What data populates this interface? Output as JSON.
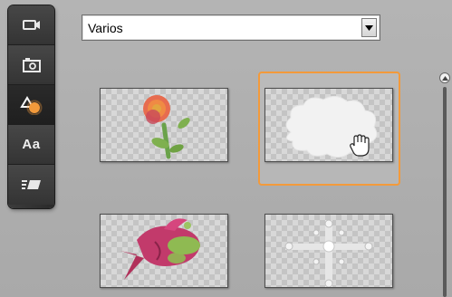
{
  "dropdown": {
    "selected": "Varios"
  },
  "toolbar": {
    "items": [
      {
        "name": "video-titles",
        "icon": "video-camera-icon"
      },
      {
        "name": "photos",
        "icon": "camera-icon"
      },
      {
        "name": "shapes",
        "icon": "shapes-icon",
        "active": true
      },
      {
        "name": "text",
        "icon": "text-aa-icon",
        "label": "Aa"
      },
      {
        "name": "transitions",
        "icon": "transition-icon"
      }
    ]
  },
  "thumbnails": [
    {
      "name": "flower",
      "icon": "flower-icon"
    },
    {
      "name": "cloud",
      "icon": "cloud-icon",
      "selected": true
    },
    {
      "name": "fish",
      "icon": "fish-icon"
    },
    {
      "name": "cross-frame",
      "icon": "cross-icon"
    }
  ],
  "colors": {
    "accent": "#f39a3b",
    "toolbar": "#333333"
  }
}
